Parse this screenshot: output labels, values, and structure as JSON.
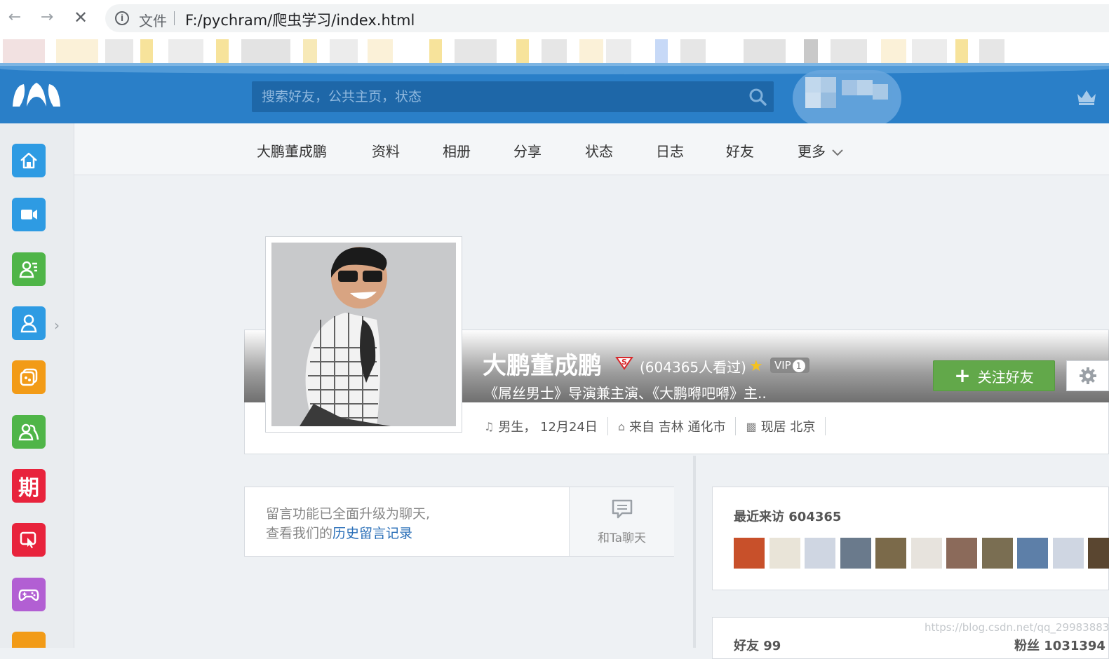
{
  "browser": {
    "scheme_label": "文件",
    "url": "F:/pychram/爬虫学习/index.html"
  },
  "search": {
    "placeholder": "搜索好友，公共主页，状态"
  },
  "sidebar": {
    "items": [
      {
        "name": "home",
        "color": "#2e9be3"
      },
      {
        "name": "video",
        "color": "#2e9be3"
      },
      {
        "name": "contacts",
        "color": "#4fb548"
      },
      {
        "name": "profile",
        "color": "#2e9be3"
      },
      {
        "name": "apps",
        "color": "#f29b17"
      },
      {
        "name": "friends",
        "color": "#4fb548"
      },
      {
        "name": "periodical",
        "color": "#e8233c",
        "label": "期"
      },
      {
        "name": "interactive",
        "color": "#e8233c"
      },
      {
        "name": "games",
        "color": "#b25fd3"
      },
      {
        "name": "more-app",
        "color": "#f29b17"
      }
    ]
  },
  "subnav": {
    "tabs": [
      "大鹏董成鹏",
      "资料",
      "相册",
      "分享",
      "状态",
      "日志",
      "好友",
      "更多"
    ]
  },
  "profile": {
    "name": "大鹏董成鹏",
    "views": "(604365人看过)",
    "vip_label": "VIP",
    "vip_level": "1",
    "bio": "《屌丝男士》导演兼主演、《大鹏嘚吧嘚》主..",
    "follow_label": "关注好友",
    "gender_birthday": "男生，  12月24日",
    "hometown": "来自 吉林 通化市",
    "residence": "现居 北京"
  },
  "message": {
    "line1": "留言功能已全面升级为聊天,",
    "line2_prefix": "查看我们的",
    "link": "历史留言记录",
    "chat_label": "和Ta聊天"
  },
  "visitors": {
    "title": "最近来访 604365",
    "avatars": [
      "#c8502a",
      "#e9e4d8",
      "#cfd6e2",
      "#6a7a8c",
      "#7b6a4a",
      "#e7e3dd",
      "#8b6a5a",
      "#7a6e52",
      "#5d7fa8",
      "#cfd6e2",
      "#5a4630"
    ]
  },
  "friends": {
    "title": "好友 99",
    "fans": "粉丝 1031394"
  },
  "watermark": "https://blog.csdn.net/qq_29983883",
  "colors": {
    "topbar": "#2a7fc8",
    "follow": "#62a84a",
    "link": "#2a6fb8"
  }
}
